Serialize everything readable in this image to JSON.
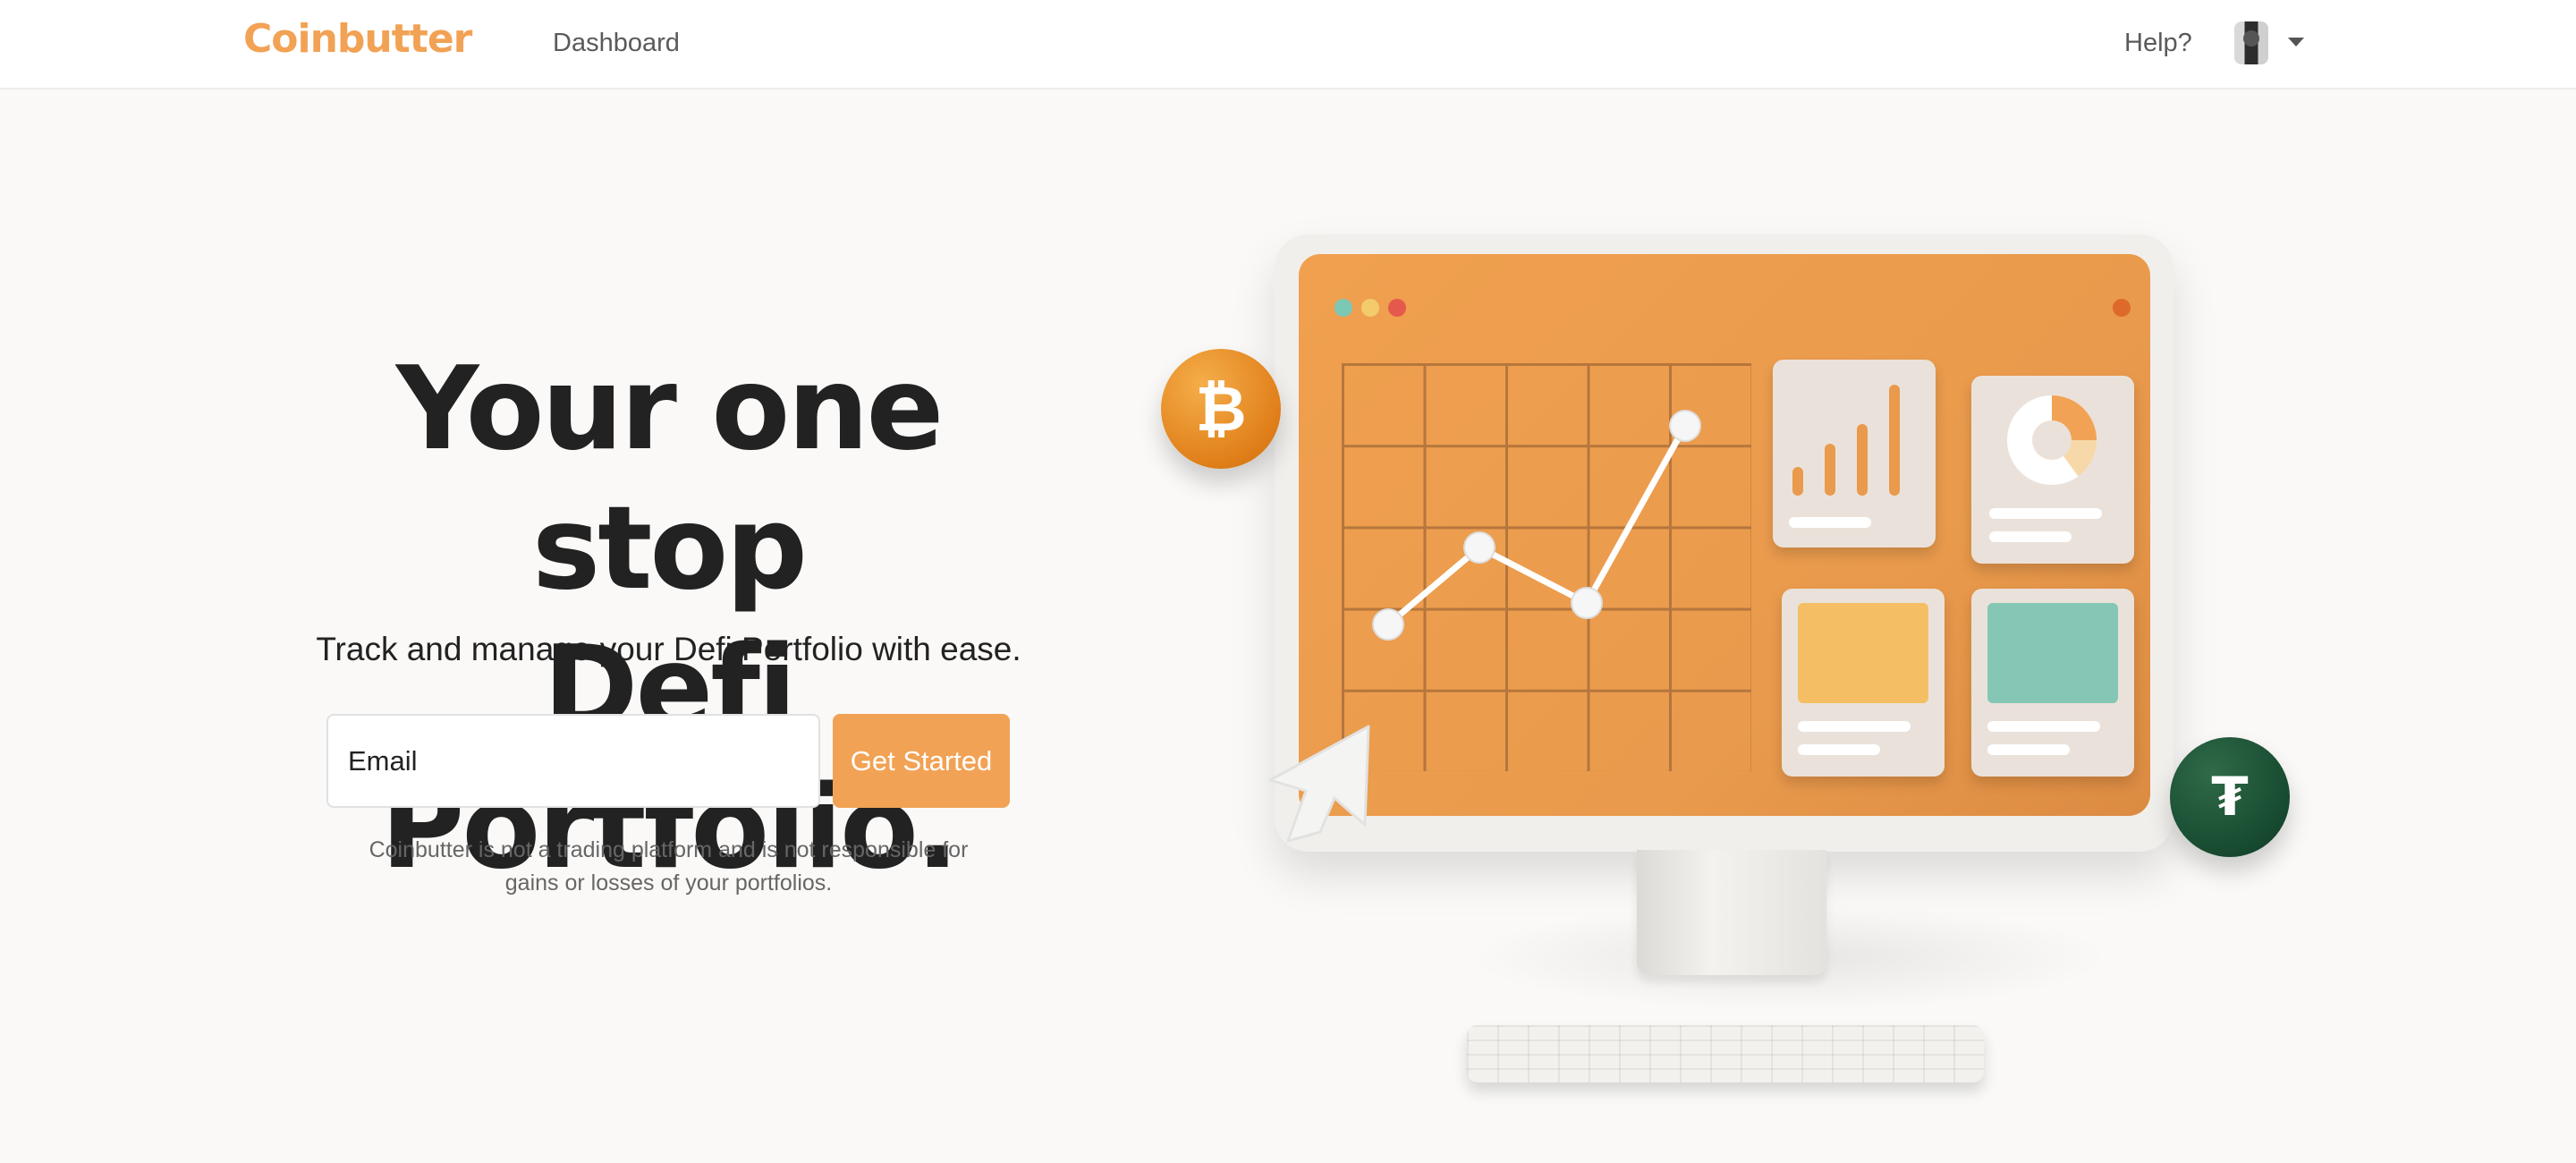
{
  "header": {
    "brand": "Coinbutter",
    "nav_dashboard": "Dashboard",
    "help": "Help?"
  },
  "hero": {
    "headline_line1": "Your one stop",
    "headline_line2": "Defi Portfolio.",
    "subheading": "Track and manage your Defi Portfolio with ease.",
    "email_placeholder": "Email",
    "cta_label": "Get Started",
    "disclaimer": "Coinbutter is not a trading platform and is not responsible for gains or losses of your portfolios."
  },
  "illustration": {
    "coins": [
      "bitcoin-icon",
      "tether-icon"
    ],
    "btc_glyph": "₿",
    "usdt_glyph": "₮"
  },
  "colors": {
    "accent": "#f2a254",
    "text": "#222222",
    "background": "#faf9f7"
  }
}
